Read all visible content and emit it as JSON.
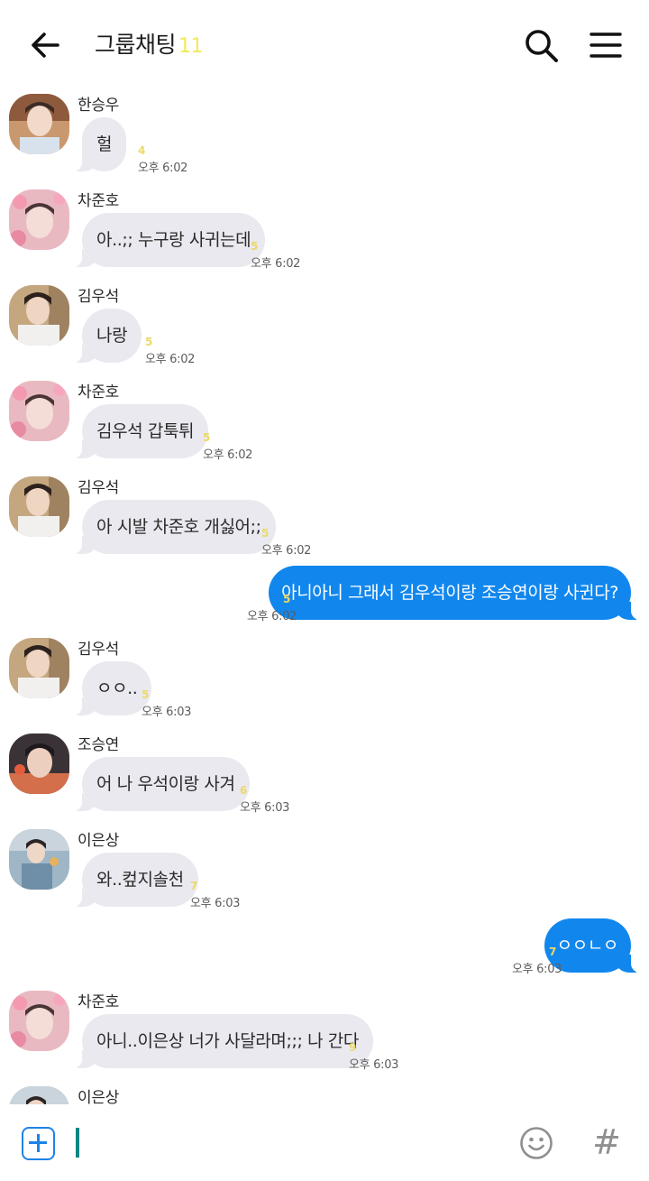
{
  "header": {
    "title": "그룹채팅",
    "member_count": "11",
    "back_icon": "arrow-left-icon",
    "search_icon": "search-icon",
    "menu_icon": "hamburger-menu-icon"
  },
  "messages": [
    {
      "type": "in",
      "sender": "한승우",
      "text": "헐",
      "unread": "4",
      "time": "오후 6:02"
    },
    {
      "type": "in",
      "sender": "차준호",
      "text": "아..;; 누구랑 사귀는데",
      "unread": "5",
      "time": "오후 6:02"
    },
    {
      "type": "in",
      "sender": "김우석",
      "text": "나랑",
      "unread": "5",
      "time": "오후 6:02"
    },
    {
      "type": "in",
      "sender": "차준호",
      "text": "김우석 갑툭튀",
      "unread": "5",
      "time": "오후 6:02"
    },
    {
      "type": "in",
      "sender": "김우석",
      "text": "아 시발 차준호 개싫어;;",
      "unread": "5",
      "time": "오후 6:02"
    },
    {
      "type": "out",
      "text": "아니아니 그래서 김우석이랑 조승연이랑 사귄다?",
      "unread": "5",
      "time": "오후 6:02"
    },
    {
      "type": "in",
      "sender": "김우석",
      "text": "ㅇㅇ..",
      "unread": "5",
      "time": "오후 6:03"
    },
    {
      "type": "in",
      "sender": "조승연",
      "text": "어 나 우석이랑 사겨",
      "unread": "6",
      "time": "오후 6:03"
    },
    {
      "type": "in",
      "sender": "이은상",
      "text": "와..컾지솔천",
      "unread": "7",
      "time": "오후 6:03"
    },
    {
      "type": "out",
      "text": "ㅇㅇㄴㅇ",
      "unread": "7",
      "time": "오후 6:03"
    },
    {
      "type": "in",
      "sender": "차준호",
      "text": "아니..이은상 너가 사달라며;;; 나 간다",
      "unread": "9",
      "time": "오후 6:03"
    },
    {
      "type": "in",
      "sender": "이은상",
      "text": "",
      "unread": "",
      "time": ""
    }
  ],
  "input_bar": {
    "attach_icon": "plus-square-icon",
    "emoji_icon": "smiley-icon",
    "hashtag_label": "#"
  },
  "colors": {
    "incoming_bubble": "#e9e9ef",
    "outgoing_bubble": "#1187ee",
    "unread_count": "#ecd96a",
    "member_count": "#f3ea57",
    "accent": "#1d83e6"
  }
}
